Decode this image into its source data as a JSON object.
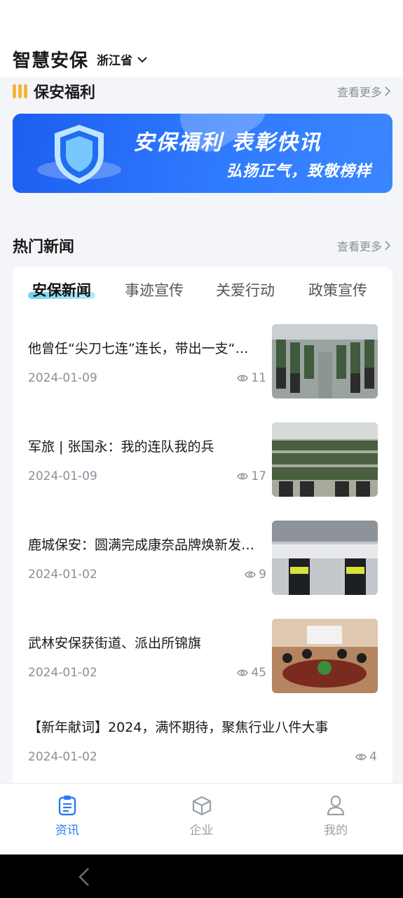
{
  "app": {
    "title": "智慧安保",
    "region": "浙江省"
  },
  "welfare": {
    "title": "保安福利",
    "more": "查看更多",
    "banner": {
      "line1": "安保福利 表彰快讯",
      "line2": "弘扬正气，致敬榜样"
    }
  },
  "hot_news": {
    "title": "热门新闻",
    "more": "查看更多",
    "tabs": [
      "安保新闻",
      "事迹宣传",
      "关爱行动",
      "政策宣传"
    ],
    "active_tab": 0,
    "items": [
      {
        "title": "他曾任“尖刀七连”连长，带出一支“虎狼之师”",
        "date": "2024-01-09",
        "views": "11"
      },
      {
        "title": "军旅 | 张国永：我的连队我的兵",
        "date": "2024-01-09",
        "views": "17"
      },
      {
        "title": "鹿城保安：圆满完成康奈品牌焕新发布会安保工作",
        "date": "2024-01-02",
        "views": "9"
      },
      {
        "title": "武林安保获街道、派出所锦旗",
        "date": "2024-01-02",
        "views": "45"
      },
      {
        "title": "【新年献词】2024，满怀期待，聚焦行业八件大事",
        "date": "2024-01-02",
        "views": "4"
      }
    ]
  },
  "nav": {
    "items": [
      {
        "label": "资讯",
        "icon": "news-icon"
      },
      {
        "label": "企业",
        "icon": "enterprise-icon"
      },
      {
        "label": "我的",
        "icon": "profile-icon"
      }
    ],
    "active": 0
  },
  "colors": {
    "accent": "#2a7bf3",
    "banner": "#2f7bff",
    "muted": "#8a8f99"
  }
}
